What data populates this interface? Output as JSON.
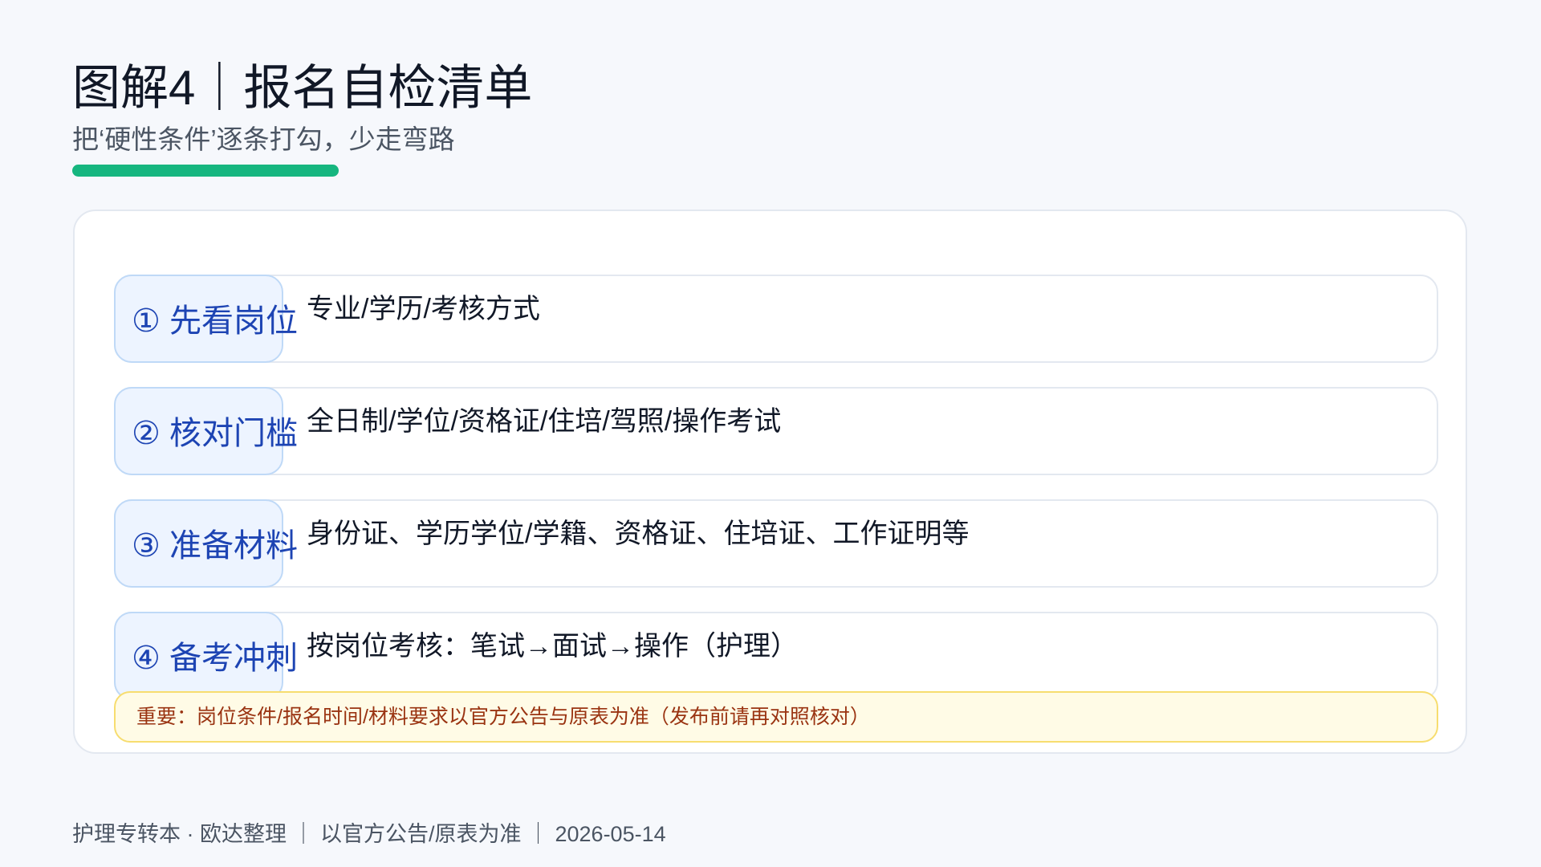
{
  "header": {
    "title": "图解4｜报名自检清单",
    "subtitle": "把‘硬性条件’逐条打勾，少走弯路"
  },
  "steps": [
    {
      "label": "① 先看岗位",
      "desc": "专业/学历/考核方式"
    },
    {
      "label": "② 核对门槛",
      "desc": "全日制/学位/资格证/住培/驾照/操作考试"
    },
    {
      "label": "③ 准备材料",
      "desc": "身份证、学历学位/学籍、资格证、住培证、工作证明等"
    },
    {
      "label": "④ 备考冲刺",
      "desc": "按岗位考核：笔试→面试→操作（护理）"
    }
  ],
  "notice": "重要：岗位条件/报名时间/材料要求以官方公告与原表为准（发布前请再对照核对）",
  "footer": "护理专转本 · 欧达整理 ｜ 以官方公告/原表为准 ｜ 2026-05-14",
  "colors": {
    "accent": "#16b67f",
    "step_label_text": "#1d44b3",
    "step_label_bg": "#edf4ff",
    "notice_bg": "#fffbe6",
    "notice_text": "#9a3412"
  }
}
